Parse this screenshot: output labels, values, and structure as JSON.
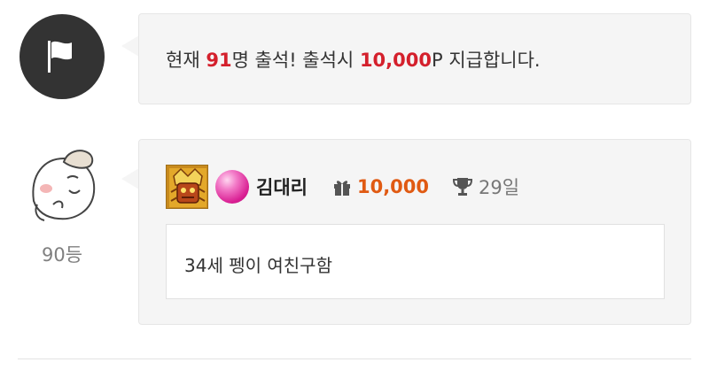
{
  "notice": {
    "prefix": "현재 ",
    "count": "91",
    "middle": "명 출석! 출석시 ",
    "reward": "10,000",
    "suffix": "P 지급합니다."
  },
  "entry": {
    "rank": "90등",
    "nickname": "김대리",
    "points": "10,000",
    "days": "29일",
    "comment": "34세 펭이 여친구함"
  },
  "colors": {
    "highlight_red": "#d4202c",
    "points_orange": "#e05a12",
    "notice_icon_bg": "#333333",
    "bubble_bg": "#f5f5f5"
  },
  "icons": {
    "notice": "flag-icon",
    "gift": "gift-icon",
    "trophy": "trophy-icon",
    "level": "level-badge-icon",
    "gem": "pink-gem-icon"
  }
}
